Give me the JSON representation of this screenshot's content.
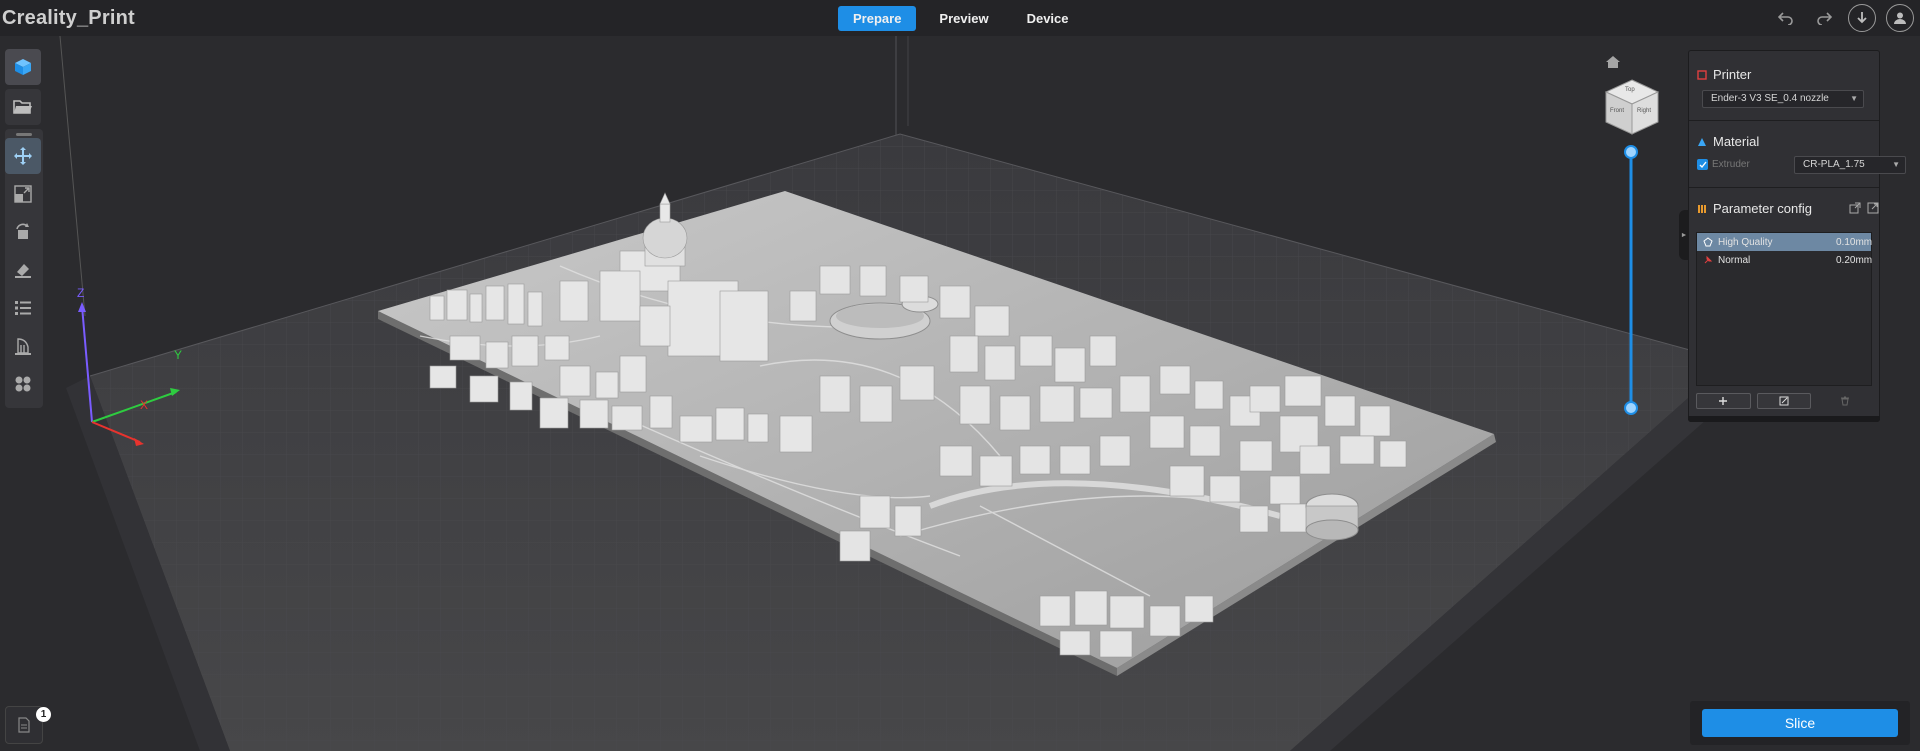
{
  "app": {
    "title": "Creality_Print"
  },
  "tabs": [
    {
      "label": "Prepare",
      "active": true
    },
    {
      "label": "Preview",
      "active": false
    },
    {
      "label": "Device",
      "active": false
    }
  ],
  "top_icons": [
    "undo-icon",
    "redo-icon",
    "download-icon",
    "user-icon"
  ],
  "left_toolbar": [
    "add-model-icon",
    "open-file-icon",
    "move-icon",
    "scale-icon",
    "rotate-icon",
    "paint-icon",
    "list-icon",
    "support-icon",
    "arrange-icon"
  ],
  "viewport": {
    "axes": {
      "x": "X",
      "y": "Y",
      "z": "Z"
    },
    "cube": {
      "top": "Top",
      "front": "Front",
      "right": "Right"
    },
    "object_list_count": "1"
  },
  "printer": {
    "title": "Printer",
    "selected": "Ender-3 V3 SE_0.4 nozzle"
  },
  "material": {
    "title": "Material",
    "extruder_label": "Extruder",
    "selected": "CR-PLA_1.75"
  },
  "parameter": {
    "title": "Parameter config",
    "profiles": [
      {
        "name": "High Quality",
        "value": "0.10mm",
        "selected": true
      },
      {
        "name": "Normal",
        "value": "0.20mm",
        "selected": false
      }
    ]
  },
  "actions": {
    "slice_label": "Slice"
  },
  "colors": {
    "accent": "#1e8ee6",
    "selected_row": "#6d88a3"
  }
}
